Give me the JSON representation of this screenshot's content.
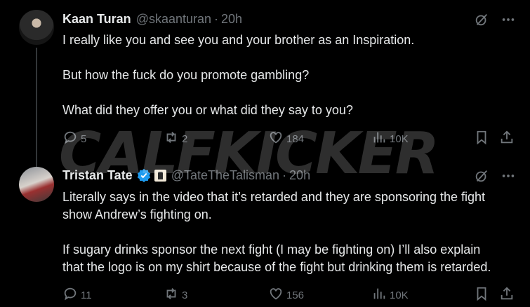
{
  "tweets": [
    {
      "name": "Kaan Turan",
      "handle": "@skaanturan",
      "separator": "·",
      "time": "20h",
      "lines": [
        "I really like you and see you and your brother as an Inspiration.",
        "",
        "But how the fuck do you promote gambling?",
        "",
        "What did they offer you or what did they say to you?"
      ],
      "replies": "5",
      "reposts": "2",
      "likes": "184",
      "views": "10K",
      "icons": [
        "grok-icon",
        "more-icon",
        "reply-icon",
        "repost-icon",
        "like-icon",
        "views-icon",
        "bookmark-icon",
        "share-icon"
      ]
    },
    {
      "name": "Tristan Tate",
      "handle": "@TateTheTalisman",
      "separator": "·",
      "time": "20h",
      "verified": true,
      "lines": [
        "Literally says in the video that it’s retarded and they are sponsoring the fight",
        "show Andrew’s fighting on.",
        "",
        "If sugary drinks sponsor the next fight (I may be fighting on) I’ll also explain",
        "that the logo is on my shirt because of the fight but drinking them is retarded."
      ],
      "replies": "11",
      "reposts": "3",
      "likes": "156",
      "views": "10K",
      "icons": [
        "verified-badge-icon",
        "affiliate-badge-icon",
        "grok-icon",
        "more-icon",
        "reply-icon",
        "repost-icon",
        "like-icon",
        "views-icon",
        "bookmark-icon",
        "share-icon"
      ]
    }
  ],
  "watermark": "CALFKICKER",
  "colors": {
    "background": "#000000",
    "text": "#e7e9ea",
    "muted": "#71767b",
    "verified": "#1d9bf0",
    "thread_line": "#333639"
  }
}
